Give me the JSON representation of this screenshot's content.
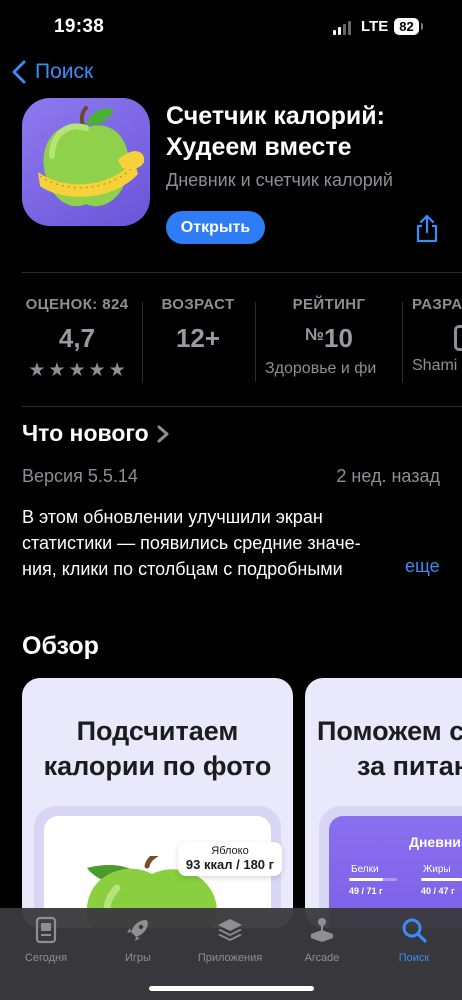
{
  "status_bar": {
    "time": "19:38",
    "network": "LTE",
    "battery": "82"
  },
  "nav": {
    "back_label": "Поиск"
  },
  "app": {
    "title_line1": "Счетчик калорий:",
    "title_line2": "Худеем вместе",
    "subtitle": "Дневник и счетчик калорий",
    "open_label": "Открыть"
  },
  "stats": [
    {
      "header": "ОЦЕНОК: 824",
      "value": "4,7",
      "stars": 5
    },
    {
      "header": "ВОЗРАСТ",
      "value": "12+"
    },
    {
      "header": "РЕЙТИНГ",
      "value_prefix": "№",
      "value": "10",
      "sub": "Здоровье и фи"
    },
    {
      "header": "РАЗРА",
      "sub": "Shami"
    }
  ],
  "whats_new": {
    "title": "Что нового",
    "version": "Версия 5.5.14",
    "date": "2 нед. назад",
    "line1": "В этом обновлении улучшили экран",
    "line2": "статистики — появились средние значе-",
    "line3": "ния, клики по столбцам с подробными",
    "more": "еще"
  },
  "overview": {
    "title": "Обзор",
    "cards": [
      {
        "line1": "Подсчитаем",
        "line2": "калории по фото",
        "food_name": "Яблоко",
        "food_kcal": "93 ккал",
        "food_weight": "180 г",
        "separator": " / "
      },
      {
        "line1": "Поможем с",
        "line2": "за питан",
        "screen_title": "Дневни",
        "macro1_name": "Белки",
        "macro1_val": "49 / 71 г",
        "macro2_name": "Жиры",
        "macro2_val": "40 / 47 г"
      }
    ]
  },
  "tabs": [
    {
      "label": "Сегодня",
      "icon": "today-icon"
    },
    {
      "label": "Игры",
      "icon": "games-rocket-icon"
    },
    {
      "label": "Приложения",
      "icon": "apps-layers-icon"
    },
    {
      "label": "Arcade",
      "icon": "arcade-joystick-icon"
    },
    {
      "label": "Поиск",
      "icon": "search-icon",
      "active": true
    }
  ],
  "colors": {
    "accent": "#2f7df6",
    "link": "#3b8cf5",
    "app_icon_bg": "#7b66e6",
    "card_bg": "#eae8fb"
  }
}
